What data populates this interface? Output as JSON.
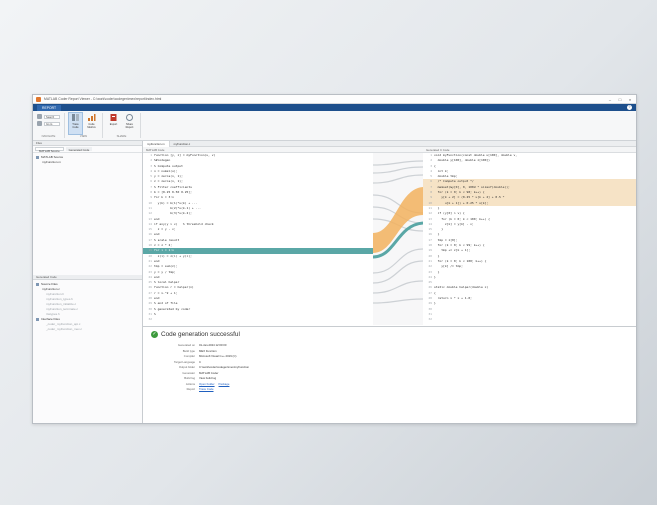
{
  "window": {
    "title": "MATLAB Coder Report Viewer - C:\\work\\coder\\codegen\\mex\\report\\index.html",
    "controls": [
      "–",
      "□",
      "×"
    ]
  },
  "ribbon": {
    "tabs": [
      "REPORT"
    ],
    "help": "?",
    "groups": [
      {
        "label": "NAVIGATE",
        "fields": [
          "Search",
          "Go to"
        ]
      },
      {
        "label": "VIEW",
        "buttons": [
          "Trace Code",
          "Code Metrics"
        ]
      },
      {
        "label": "SHARE",
        "buttons": [
          "Export",
          "Share Report"
        ]
      }
    ]
  },
  "left_panel": {
    "header": "Files",
    "tabs": [
      "MATLAB Source",
      "Generated Code"
    ],
    "tree": [
      "MATLAB Source",
      "myFunction.m"
    ],
    "lower_header": "Generated Code",
    "lower_tree": [
      "Source Files",
      "myFunction.c",
      "myFunction.h",
      "myFunction_types.h",
      "myFunction_initialize.c",
      "myFunction_terminate.c",
      "rtwtypes.h",
      "Interface Files",
      "_coder_myFunction_api.c",
      "_coder_myFunction_mex.c"
    ]
  },
  "editor": {
    "tabs": [
      "myFunction.m",
      "myFunction.c"
    ],
    "left_header": "MATLAB Code",
    "right_header": "Generated C Code",
    "left_lines": [
      "function [y, z] = myFunction(u, v)",
      "%#codegen",
      "% Compute output",
      "n = numel(u);",
      "y = zeros(n, 1);",
      "z = zeros(n, 1);",
      "% Filter coefficients",
      "b = [0.25 0.50 0.25];",
      "for k = 3:n",
      "  y(k) = b(1)*u(k) + ...",
      "         b(2)*u(k-1) + ...",
      "         b(3)*u(k-2);",
      "end",
      "if any(y > v)   % threshold check",
      "  z = y - v;",
      "end",
      "% scale result",
      "z = z * 2;",
      "for i = 1:n",
      "  z(i) = z(i) + y(i);",
      "end",
      "tmp = sum(z);",
      "y = y / tmp;",
      "end",
      "% local helper",
      "function r = helper(x)",
      "r = x.^2 + 1;",
      "end",
      "% end of file",
      "% generated by coder",
      "% ",
      ""
    ],
    "left_highlight_index": 18,
    "right_lines": [
      "void myFunction(const double u[100], double v,",
      "  double y[100], double z[100])",
      "{",
      "  int k;",
      "  double tmp;",
      "  /* Compute output */",
      "  memset(&y[0], 0, 100U * sizeof(double));",
      "  for (k = 0; k < 98; k++) {",
      "    y[k + 2] = (0.25 * u[k + 2] + 0.5 *",
      "      u[k + 1]) + 0.25 * u[k];",
      "  }",
      "  if (y[0] > v) {",
      "    for (k = 0; k < 100; k++) {",
      "      z[k] = y[k] - v;",
      "    }",
      "  }",
      "  tmp = z[0];",
      "  for (k = 0; k < 99; k++) {",
      "    tmp += z[k + 1];",
      "  }",
      "  for (k = 0; k < 100; k++) {",
      "    y[k] /= tmp;",
      "  }",
      "}",
      "",
      "static double helper(double x)",
      "{",
      "  return x * x + 1.0;",
      "}",
      "",
      "",
      ""
    ],
    "right_highlight_indices": [
      5,
      6,
      7,
      8,
      9
    ]
  },
  "report": {
    "title": "Code generation successful",
    "rows": [
      {
        "key": "Generated on",
        "value": "01-Jan-2024 12:00:00"
      },
      {
        "key": "Build type",
        "value": "MEX Function"
      },
      {
        "key": "Compiler",
        "value": "Microsoft Visual C++ 2019 (C)"
      },
      {
        "key": "Target Language",
        "value": "C"
      },
      {
        "key": "Output folder",
        "value": "C:\\work\\coder\\codegen\\mex\\myFunction"
      },
      {
        "key": "Generator",
        "value": "MATLAB Coder"
      },
      {
        "key": "Build log",
        "value": "View build log"
      },
      {
        "key": "Actions",
        "links": [
          "Open Folder",
          "Package"
        ]
      },
      {
        "key": "Report",
        "links": [
          "Trace Code"
        ]
      }
    ]
  },
  "colors": {
    "ribbon_blue": "#1d4f8c",
    "trace_teal": "#5aa7a6",
    "trace_orange": "#f2b25e",
    "success_green": "#3c9a3c"
  }
}
